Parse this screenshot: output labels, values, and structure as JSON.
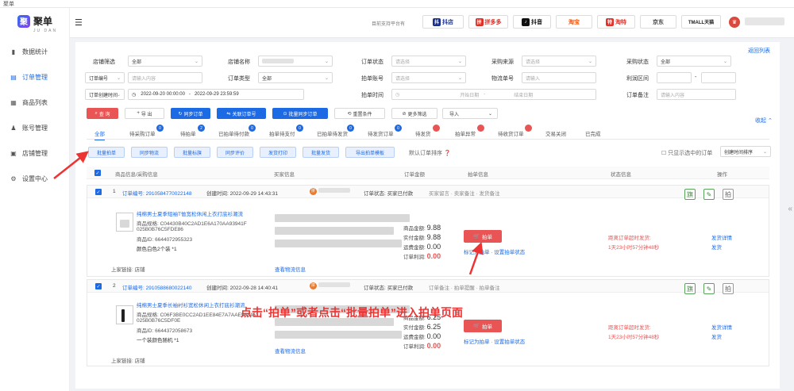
{
  "window": {
    "title": "聚单"
  },
  "brand": {
    "name": "聚单",
    "subtitle": "JU DAN",
    "mark": "聚"
  },
  "sidebar": {
    "items": [
      {
        "icon": "bar-chart-icon",
        "glyph": "▮",
        "label": "数据统计"
      },
      {
        "icon": "order-icon",
        "glyph": "▤",
        "label": "订单管理",
        "active": true
      },
      {
        "icon": "product-icon",
        "glyph": "▦",
        "label": "商品列表"
      },
      {
        "icon": "user-icon",
        "glyph": "♟",
        "label": "账号管理"
      },
      {
        "icon": "shop-icon",
        "glyph": "▣",
        "label": "店铺管理"
      },
      {
        "icon": "settings-icon",
        "glyph": "⚙",
        "label": "设置中心"
      }
    ]
  },
  "topbar": {
    "platform_label": "目前支持平台有",
    "platforms": [
      {
        "name": "抖店",
        "color": "#1a2f8a"
      },
      {
        "name": "拼多多",
        "color": "#e02e24"
      },
      {
        "name": "抖音",
        "color": "#111111"
      },
      {
        "name": "淘宝",
        "color": "#ff5000"
      },
      {
        "name": "淘特",
        "color": "#e5312a"
      },
      {
        "name": "京东",
        "color": "#444444"
      },
      {
        "name": "TMALL天猫",
        "color": "#222222"
      }
    ],
    "avatar_glyph": "♛"
  },
  "filters": {
    "back_link": "返回列表",
    "row1": [
      {
        "label": "店铺筛选",
        "value": "全部"
      },
      {
        "label": "店铺名称",
        "value": ""
      },
      {
        "label": "订单状态",
        "value": "请选择"
      },
      {
        "label": "采购来源",
        "value": "请选择"
      },
      {
        "label": "采购状态",
        "value": "全部"
      }
    ],
    "row2": [
      {
        "label": "订单编号",
        "value": "请输入内容"
      },
      {
        "label": "订单类型",
        "value": "全部"
      },
      {
        "label": "拍单账号",
        "value": "请选择"
      },
      {
        "label": "物流单号",
        "value": "请输入"
      },
      {
        "label": "利润区间",
        "value": "-"
      }
    ],
    "row3": [
      {
        "label": "订单创建时间",
        "value": "2022-09-20 00:00:00",
        "value2": "2022-09-29 23:59:59"
      },
      {
        "label": "拍单时间",
        "value": "开始日期",
        "value2": "结束日期"
      },
      {
        "label": "订单备注",
        "value": "请输入内容"
      }
    ]
  },
  "actions": {
    "query": "查 询",
    "export": "导 出",
    "sync": "同步订单",
    "associate": "关联订单号",
    "batch_sync": "批量同步订单",
    "reset": "重置条件",
    "more": "更多筛选",
    "count": "导入",
    "collapse": "收起"
  },
  "tabs": [
    {
      "label": "全部",
      "badge": ""
    },
    {
      "label": "待采购订单",
      "badge": "0"
    },
    {
      "label": "待拍单",
      "badge": "2"
    },
    {
      "label": "已拍单待付款",
      "badge": "0"
    },
    {
      "label": "拍单待支付",
      "badge": "0"
    },
    {
      "label": "已拍单待发货",
      "badge": "0"
    },
    {
      "label": "待发货订单",
      "badge": "0"
    },
    {
      "label": "待发货",
      "badge": "0"
    },
    {
      "label": "拍单异常",
      "badge": "0"
    },
    {
      "label": "待收货订单",
      "badge": "0"
    },
    {
      "label": "交易关闭",
      "badge": ""
    },
    {
      "label": "已完成",
      "badge": ""
    }
  ],
  "bulk": {
    "buttons": [
      "批量拍单",
      "同步物流",
      "批量标旗",
      "同步评价",
      "发货打印",
      "批量发货",
      "导出拍单模板"
    ],
    "note": "默认订单排序",
    "only_checked": "只显示选中的订单",
    "sort": "创建时间排序"
  },
  "table": {
    "headers": [
      "商品信息/采购信息",
      "买家信息",
      "订单金额",
      "拍单信息",
      "状态信息",
      "操作"
    ]
  },
  "orders": [
    {
      "index": "1",
      "order_no": "订单编号: 2910584770022148",
      "time_label": "创建时间: 2022-09-29 14:43:31",
      "status": "订单状态: 买家已付款",
      "tags": "买家留言 · 卖家备注 · 发货备注",
      "title": "纯棉男士夏季短袖T恤宽松休闲上衣打底衫潮流",
      "sku": "商品规格: C04430B40C2AD1E6A170AA93941F",
      "sku2": "025B0B76C5FDE86",
      "item_id": "商品ID: 6644072955323",
      "qty": "颜色白色2个装 *1",
      "shipping": "上家链接: 店铺",
      "view_logistics": "查看物流信息",
      "pay": {
        "total_label": "商品金额:",
        "total": "9.88",
        "paid_label": "实付金额:",
        "paid": "9.88",
        "fee_label": "运费金额:",
        "fee": "0.00",
        "profit_label": "订单利润:",
        "profit": "0.00"
      },
      "pai_label": "拍单",
      "pai_links": "标记为拍单 · 设置拍单状态",
      "remain": "距离订单超时发货:",
      "remain_time": "1天23小时57分钟48秒",
      "op1": "发货详情",
      "op2": "发货"
    },
    {
      "index": "2",
      "order_no": "订单编号: 2910588680022140",
      "time_label": "创建时间: 2022-09-28 14:40:41",
      "status": "订单状态: 买家已付款",
      "tags": "订单备注 · 拍单提醒 · 拍单备注",
      "title": "纯棉男士夏季长袖衬衫宽松休闲上衣打底衫潮流",
      "sku": "商品规格: C06F3BE0CC2AD1EE84E7A7AAE563451",
      "sku2": "025B0B76C5DF0E",
      "item_id": "商品ID: 6644372058673",
      "qty": "一个装颜色随机 *1",
      "shipping": "上家链接: 店铺",
      "view_logistics": "查看物流信息",
      "pay": {
        "total_label": "商品金额:",
        "total": "6.25",
        "paid_label": "实付金额:",
        "paid": "6.25",
        "fee_label": "运费金额:",
        "fee": "0.00",
        "profit_label": "订单利润:",
        "profit": "0.00"
      },
      "pai_label": "拍单",
      "pai_links": "标记为拍单 · 设置拍单状态",
      "remain": "距离订单超时发货:",
      "remain_time": "1天23小时57分钟48秒",
      "op1": "发货详情",
      "op2": "发货"
    }
  ],
  "annotation": "点击“拍单”或者点击“批量拍单”进入拍单页面"
}
